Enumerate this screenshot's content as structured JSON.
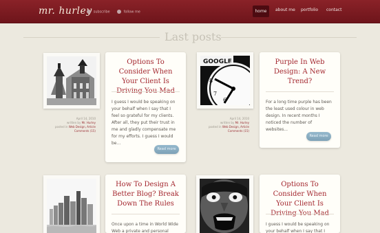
{
  "header": {
    "brand": "mr. hurley",
    "social": [
      "subscribe",
      "follow me"
    ],
    "nav": [
      "home",
      "about me",
      "portfolio",
      "contact"
    ]
  },
  "section": {
    "title": "Last posts"
  },
  "posts": [
    {
      "title": "Options To Consider When Your Client Is Driving You Mad",
      "date": "April 14, 2010",
      "author_prefix": "written by",
      "author": "Mr. Hurley",
      "posted_in_prefix": "posted in",
      "categories": "Web Design, Article",
      "comments": "Comments (15)",
      "excerpt": "I guess I would be speaking on your behalf when I say that I feel so grateful for my clients. After all, they put their trust in me and gladly compensate me for my efforts. I guess I would be...",
      "button": "Read more",
      "image": "architecture-photo"
    },
    {
      "title": "Purple In Web Design: A New Trend?",
      "date": "April 14, 2010",
      "author_prefix": "written by",
      "author": "Mr. Hurley",
      "posted_in_prefix": "posted in",
      "categories": "Web Design, Article",
      "comments": "Comments (15)",
      "excerpt": "For a long time purple has been the least used colour in web design. In recent months I noticed the number of websites...",
      "button": "Read more",
      "image": "google-clock-photo",
      "image_label": "GOOGLE"
    },
    {
      "title": "How To Design A Better Blog? Break Down The Rules",
      "excerpt": "Once upon a time in World Wide Web a private and personal diary, where",
      "image": "city-skyline-photo"
    },
    {
      "title": "Options To Consider When Your Client Is Driving You Mad",
      "excerpt": "I guess I would be speaking on your behalf when I say that I feel so",
      "image": "screaming-face-photo"
    }
  ]
}
